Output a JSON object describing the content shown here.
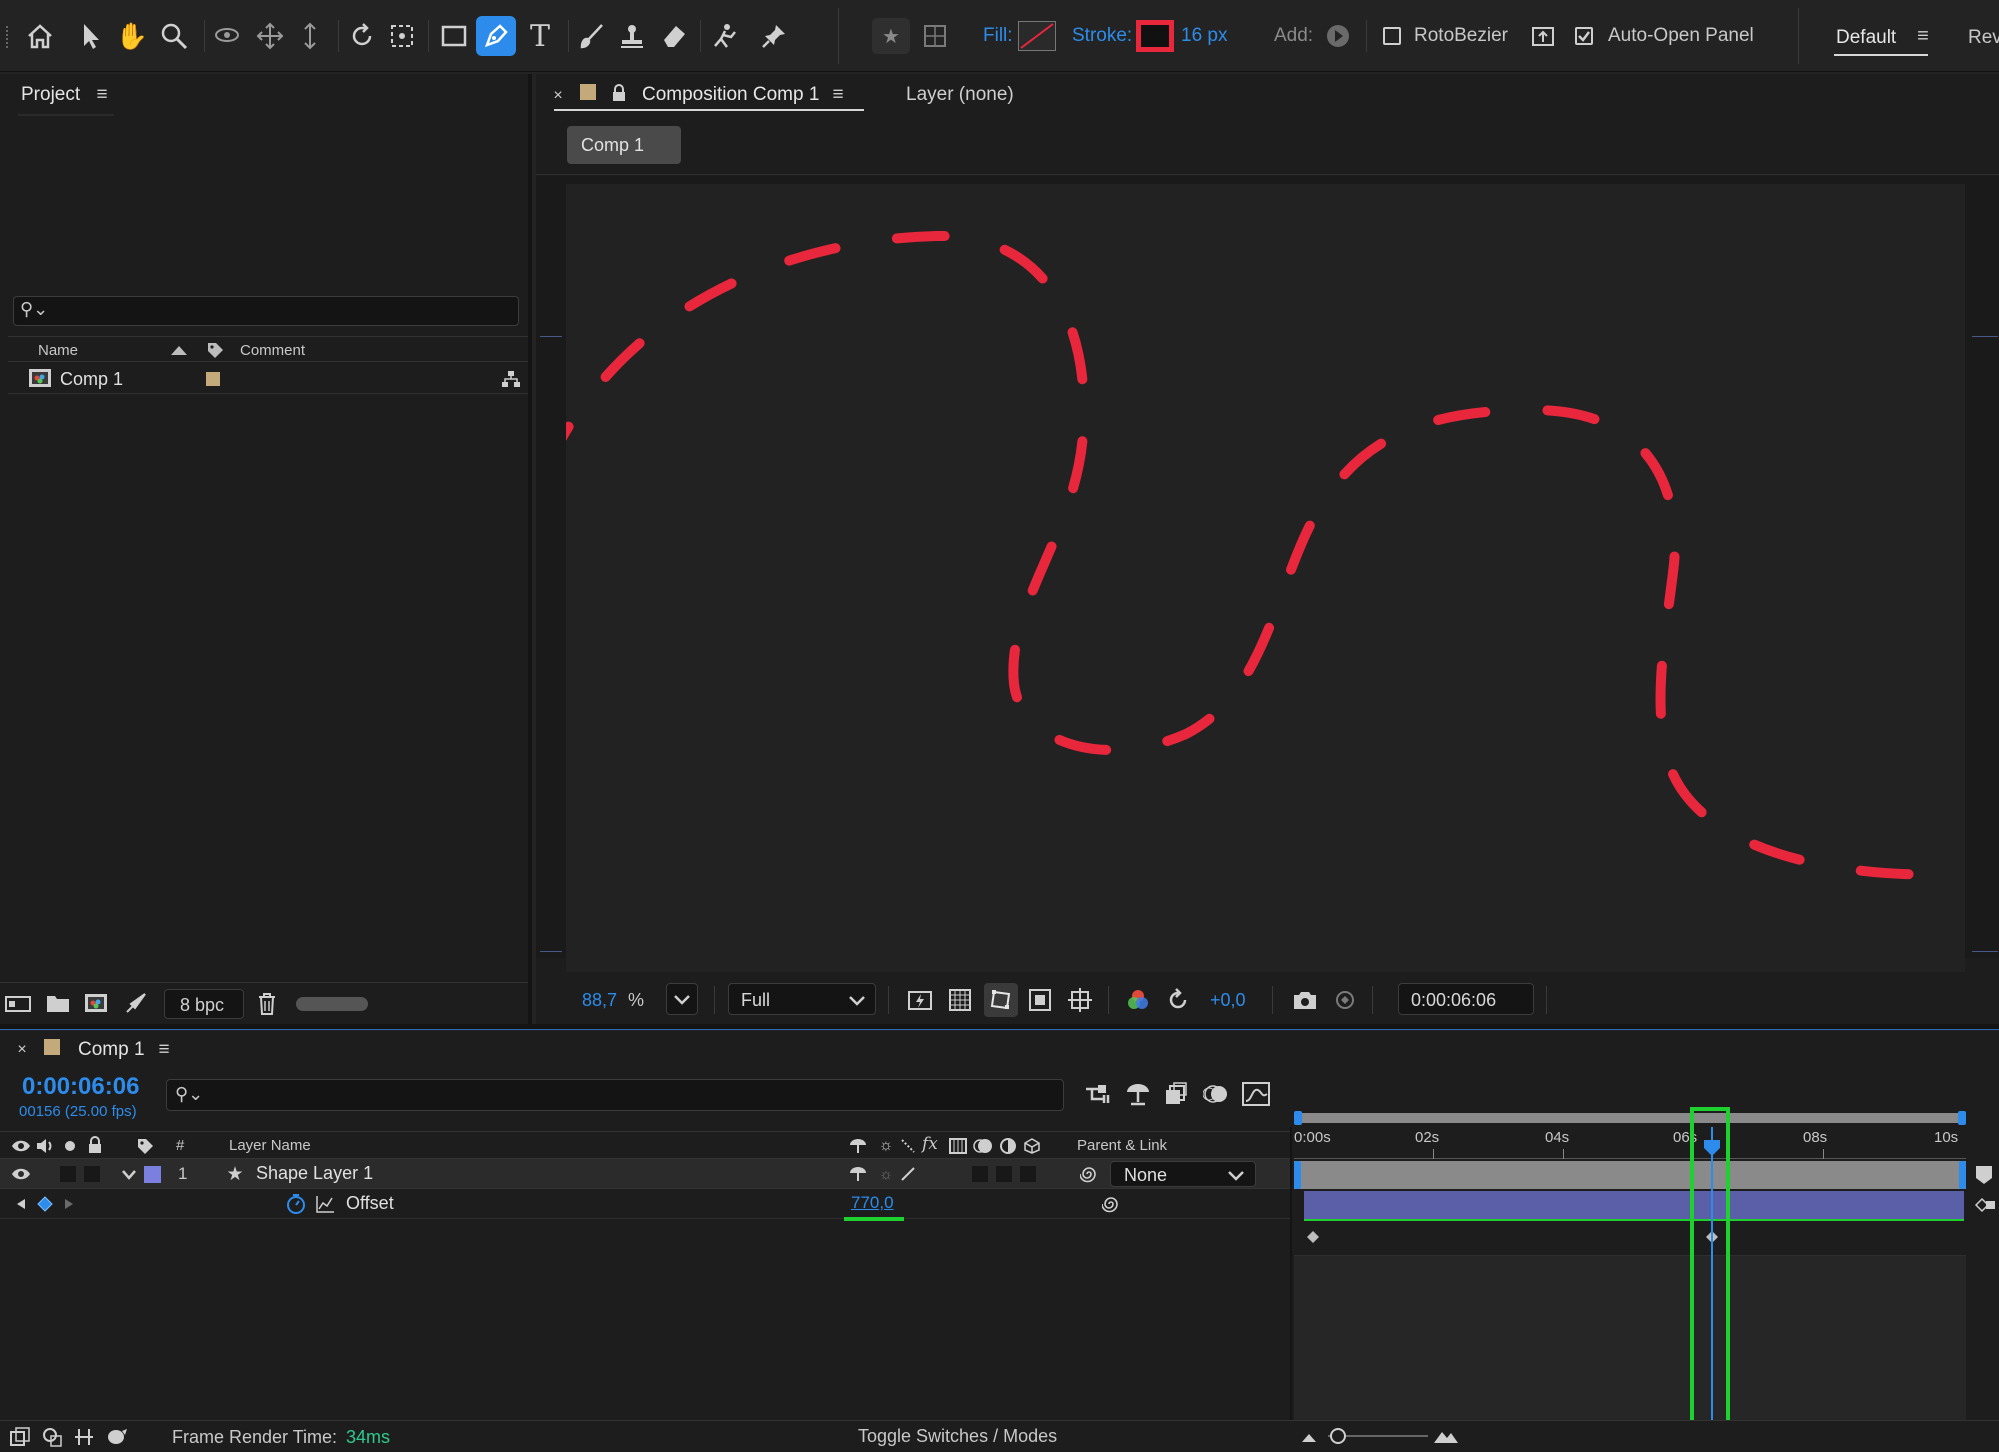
{
  "toolbar": {
    "fill_label": "Fill:",
    "stroke_label": "Stroke:",
    "stroke_width": "16 px",
    "add_label": "Add:",
    "rotobezier_label": "RotoBezier",
    "rotobezier_checked": false,
    "auto_open_label": "Auto-Open Panel",
    "auto_open_checked": true,
    "workspace_default": "Default",
    "workspace_review": "Revi",
    "stroke_color": "#e8263c",
    "accent_color": "#2d8ceb",
    "icons": [
      "home-icon",
      "selection-arrow-icon",
      "hand-icon",
      "zoom-icon",
      "orbit-camera-icon",
      "pan-camera-icon",
      "dolly-camera-icon",
      "rotate-icon",
      "anchor-icon",
      "rectangle-icon",
      "pen-icon",
      "type-icon",
      "brush-icon",
      "clone-stamp-icon",
      "eraser-icon",
      "roto-brush-icon",
      "puppet-pin-icon",
      "star-icon",
      "checker-icon"
    ]
  },
  "project": {
    "title": "Project",
    "search_placeholder": "",
    "col_name": "Name",
    "col_comment": "Comment",
    "items": [
      {
        "name": "Comp 1",
        "label_color": "#c4a97a"
      }
    ],
    "bpc": "8 bpc"
  },
  "composition": {
    "tab_label": "Composition Comp 1",
    "layer_tab_label": "Layer (none)",
    "breadcrumb": "Comp 1",
    "zoom": "88,7",
    "zoom_unit": "%",
    "resolution": "Full",
    "exposure": "+0,0",
    "timecode": "0:00:06:06",
    "stroke_color": "#e8263c"
  },
  "timeline": {
    "tab_label": "Comp 1",
    "current_time": "0:00:06:06",
    "frame_info": "00156 (25.00 fps)",
    "col_num": "#",
    "col_layer_name": "Layer Name",
    "col_parent": "Parent & Link",
    "ruler_labels": [
      "0:00s",
      "02s",
      "04s",
      "06s",
      "08s",
      "10s"
    ],
    "layer": {
      "index": "1",
      "name": "Shape Layer 1",
      "parent": "None",
      "label_color": "#7b7fe0"
    },
    "property": {
      "name": "Offset",
      "value": "770,0"
    },
    "playhead_seconds": 6.24,
    "duration_seconds": 10,
    "frame_render_label": "Frame Render Time:",
    "frame_render_value": "34ms",
    "toggle_label": "Toggle Switches / Modes",
    "highlight_color": "#1fd12f"
  }
}
